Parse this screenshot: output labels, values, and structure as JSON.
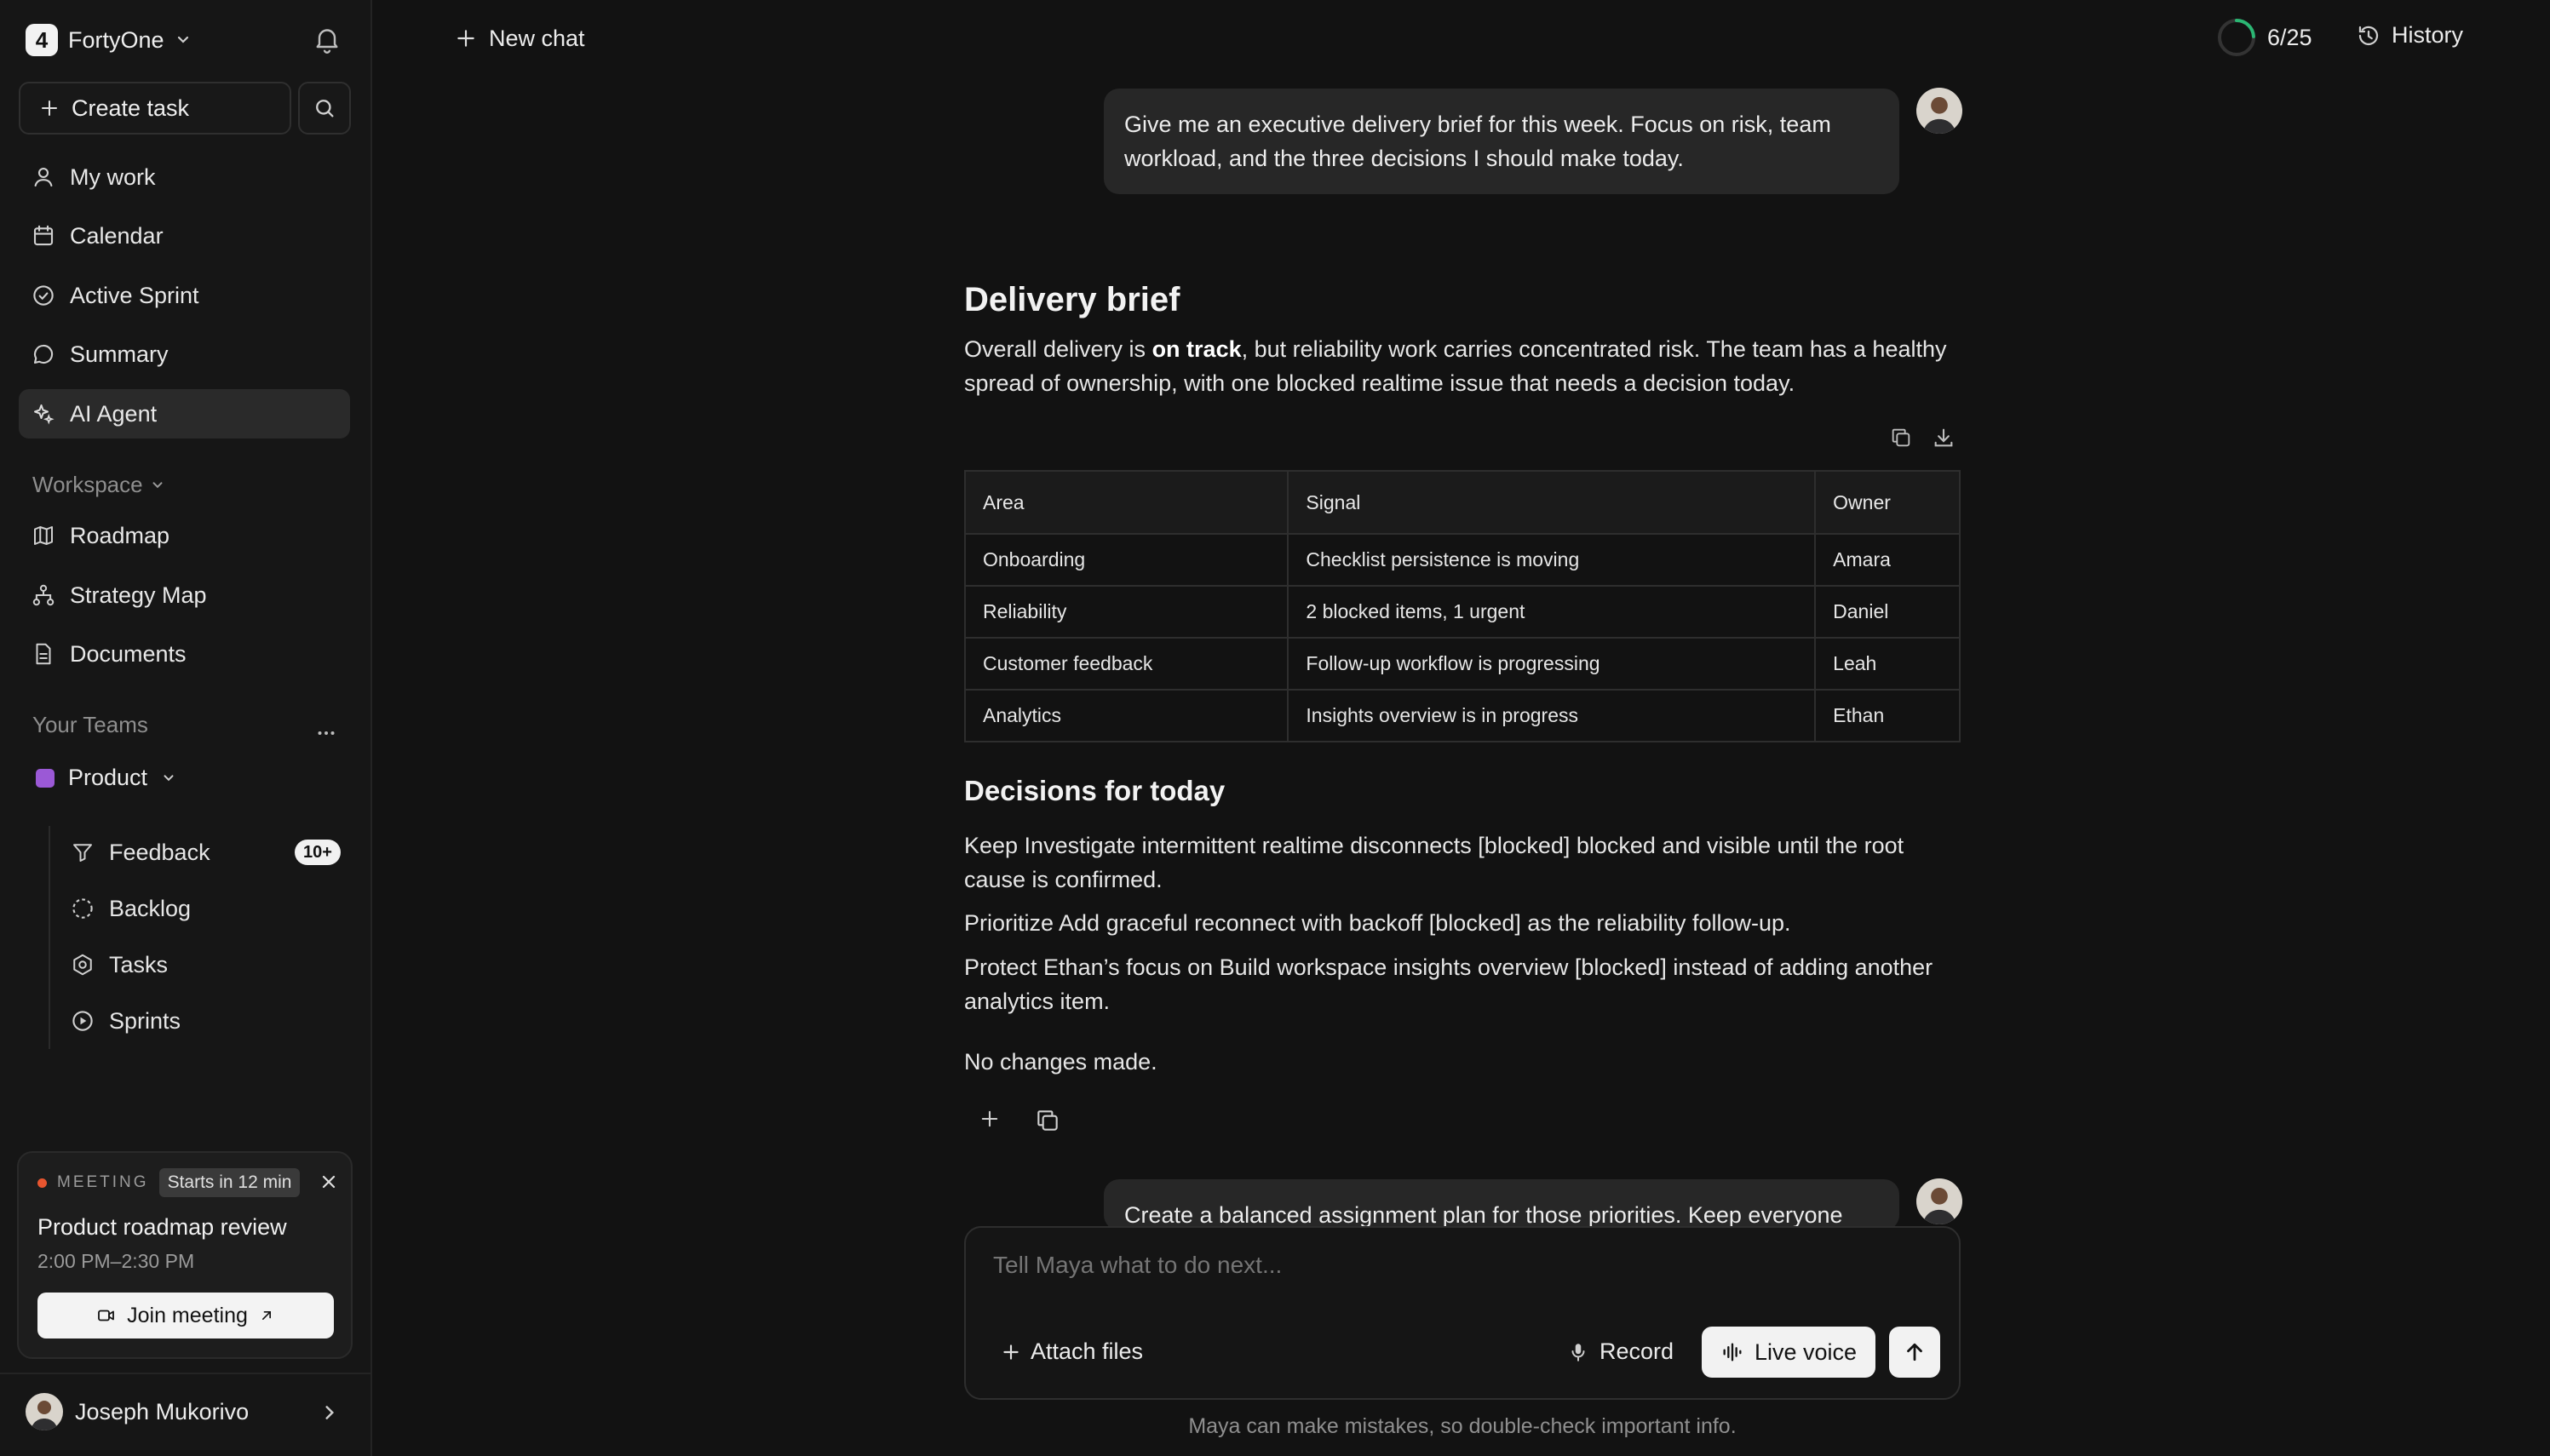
{
  "sidebar": {
    "brand": {
      "logo": "4",
      "name": "FortyOne"
    },
    "create_task": "Create task",
    "nav": [
      {
        "label": "My work",
        "icon": "user-icon"
      },
      {
        "label": "Calendar",
        "icon": "calendar-icon"
      },
      {
        "label": "Active Sprint",
        "icon": "check-circle-icon"
      },
      {
        "label": "Summary",
        "icon": "chat-icon"
      },
      {
        "label": "AI Agent",
        "icon": "sparkle-icon",
        "active": true
      }
    ],
    "workspace_label": "Workspace",
    "workspace_items": [
      {
        "label": "Roadmap",
        "icon": "map-icon"
      },
      {
        "label": "Strategy Map",
        "icon": "hierarchy-icon"
      },
      {
        "label": "Documents",
        "icon": "document-icon"
      }
    ],
    "teams_label": "Your Teams",
    "team": {
      "name": "Product",
      "color": "#9b59d6",
      "items": [
        {
          "label": "Feedback",
          "icon": "filter-icon",
          "badge": "10+"
        },
        {
          "label": "Backlog",
          "icon": "dashed-circle-icon"
        },
        {
          "label": "Tasks",
          "icon": "hexagon-icon"
        },
        {
          "label": "Sprints",
          "icon": "play-circle-icon"
        }
      ]
    },
    "meeting": {
      "label": "MEETING",
      "starts": "Starts in 12 min",
      "title": "Product roadmap review",
      "time": "2:00 PM–2:30 PM",
      "join": "Join meeting"
    },
    "user": {
      "name": "Joseph Mukorivo"
    }
  },
  "topbar": {
    "new_chat": "New chat",
    "usage": "6/25",
    "usage_fraction": 0.24,
    "history": "History"
  },
  "chat": {
    "user_message_1": "Give me an executive delivery brief for this week. Focus on risk, team workload, and the three decisions I should make today.",
    "brief_title": "Delivery brief",
    "brief_text_a": "Overall delivery is ",
    "brief_text_bold": "on track",
    "brief_text_b": ", but reliability work carries concentrated risk. The team has a healthy spread of ownership, with one blocked realtime issue that needs a decision today.",
    "table": {
      "headers": [
        "Area",
        "Signal",
        "Owner"
      ],
      "rows": [
        [
          "Onboarding",
          "Checklist persistence is moving",
          "Amara"
        ],
        [
          "Reliability",
          "2 blocked items, 1 urgent",
          "Daniel"
        ],
        [
          "Customer feedback",
          "Follow-up workflow is progressing",
          "Leah"
        ],
        [
          "Analytics",
          "Insights overview is in progress",
          "Ethan"
        ]
      ]
    },
    "decisions_title": "Decisions for today",
    "decisions": [
      "Keep Investigate intermittent realtime disconnects [blocked] blocked and visible until the root cause is confirmed.",
      "Prioritize Add graceful reconnect with backoff [blocked] as the reliability follow-up.",
      "Protect Ethan’s focus on Build workspace insights overview [blocked] instead of adding another analytics item."
    ],
    "no_changes": "No changes made.",
    "user_message_2": "Create a balanced assignment plan for those priorities. Keep everyone"
  },
  "composer": {
    "placeholder": "Tell Maya what to do next...",
    "attach": "Attach files",
    "record": "Record",
    "live_voice": "Live voice",
    "disclaimer": "Maya can make mistakes, so double-check important info."
  }
}
